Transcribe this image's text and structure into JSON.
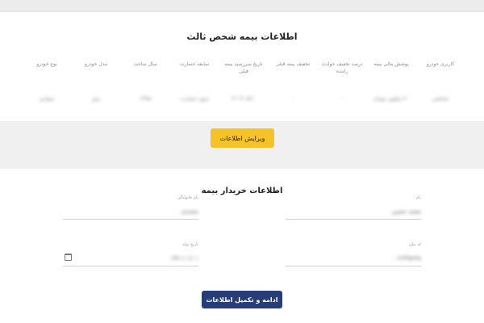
{
  "summary": {
    "title": "اطلاعات بیمه شخص ثالث",
    "columns": [
      {
        "label": "نوع خودرو",
        "value": "سواری"
      },
      {
        "label": "مدل خودرو",
        "value": "پژو"
      },
      {
        "label": "سال ساخت",
        "value": "۱۳۹۵"
      },
      {
        "label": "سابقه خسارت",
        "value": "بدون خسارت"
      },
      {
        "label": "تاریخ سررسید بیمه قبلی",
        "value": "۱۴۰۲/۰۵/۱۰"
      },
      {
        "label": "تخفیف بیمه قبلی",
        "value": "-"
      },
      {
        "label": "درصد تخفیف حوادث راننده",
        "value": "-"
      },
      {
        "label": "پوشش مالی بیمه",
        "value": "۴۰ میلیون تومان"
      },
      {
        "label": "کاربری خودرو",
        "value": "شخصی"
      }
    ],
    "edit_label": "ویرایش اطلاعات"
  },
  "buyer": {
    "title": "اطلاعات خریدار بیمه",
    "first_name": {
      "label": "نام",
      "value": "محمد حسین"
    },
    "last_name": {
      "label": "نام خانوادگی",
      "value": "محمدی"
    },
    "national_code": {
      "label": "کد ملی",
      "value": "۰۰۱۲۳۴۵۶۷۸"
    },
    "birth_date": {
      "label": "تاریخ تولد",
      "value": "۱۳۷۰/۰۱/۰۱"
    },
    "calendar_icon": "calendar-icon",
    "submit_label": "ادامه و تکمیل اطلاعات"
  }
}
